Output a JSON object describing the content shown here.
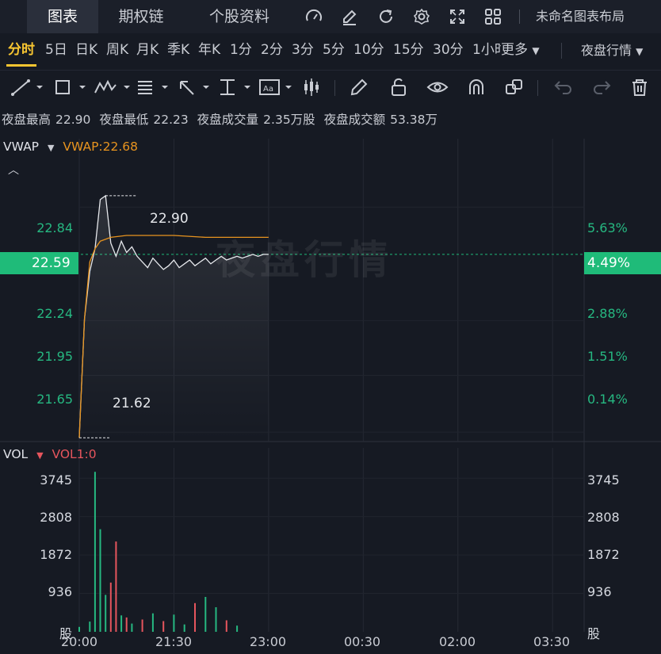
{
  "nav": {
    "tabs": [
      "图表",
      "期权链",
      "个股资料"
    ],
    "layout_label": "未命名图表布局",
    "icons": [
      "gauge-icon",
      "edit-icon",
      "refresh-icon",
      "settings-icon",
      "fullscreen-icon",
      "grid-icon"
    ]
  },
  "periods": {
    "items": [
      "分时",
      "5日",
      "日K",
      "周K",
      "月K",
      "季K",
      "年K",
      "1分",
      "2分",
      "3分",
      "5分",
      "10分",
      "15分",
      "30分",
      "1小时"
    ],
    "more_label": "更多",
    "session_label": "夜盘行情"
  },
  "stats": {
    "high_label": "夜盘最高",
    "high_value": "22.90",
    "low_label": "夜盘最低",
    "low_value": "22.23",
    "volume_label": "夜盘成交量",
    "volume_value": "2.35万股",
    "turnover_label": "夜盘成交额",
    "turnover_value": "53.38万"
  },
  "price_panel": {
    "indicator": "VWAP",
    "indicator_value": "VWAP:22.68",
    "y_labels": [
      "22.84",
      "22.24",
      "21.95",
      "21.65"
    ],
    "pct_labels": [
      "5.63%",
      "2.88%",
      "1.51%",
      "0.14%"
    ],
    "current_price": "22.59",
    "current_pct": "4.49%",
    "high_marker": "22.90",
    "low_marker": "21.62",
    "watermark": "夜盘行情"
  },
  "volume_panel": {
    "indicator": "VOL",
    "indicator_value": "VOL1:0",
    "y_labels": [
      "3745",
      "2808",
      "1872",
      "936"
    ],
    "unit": "股"
  },
  "time_axis": [
    "20:00",
    "21:30",
    "23:00",
    "00:30",
    "02:00",
    "03:30"
  ],
  "colors": {
    "up": "#26b881",
    "down": "#e6555d",
    "vwap": "#e8941f",
    "price_line": "#e6e8ec",
    "accent": "#f7c531"
  },
  "chart_data": {
    "type": "line",
    "series": [
      {
        "name": "price",
        "x": [
          "20:00",
          "20:05",
          "20:10",
          "20:15",
          "20:20",
          "20:25",
          "20:30",
          "20:35",
          "20:40",
          "20:45",
          "20:50",
          "20:55",
          "21:00",
          "21:05",
          "21:10",
          "21:15",
          "21:20",
          "21:25",
          "21:30",
          "21:35",
          "21:40",
          "21:45",
          "21:50",
          "21:55",
          "22:00",
          "22:05",
          "22:10",
          "22:15",
          "22:20",
          "22:25",
          "22:30",
          "22:35",
          "22:40",
          "22:45",
          "22:50",
          "22:55",
          "23:00"
        ],
        "values": [
          21.62,
          22.25,
          22.5,
          22.62,
          22.88,
          22.9,
          22.65,
          22.58,
          22.66,
          22.6,
          22.63,
          22.58,
          22.55,
          22.52,
          22.57,
          22.54,
          22.51,
          22.53,
          22.56,
          22.52,
          22.54,
          22.56,
          22.53,
          22.55,
          22.57,
          22.54,
          22.56,
          22.58,
          22.56,
          22.57,
          22.58,
          22.57,
          22.58,
          22.59,
          22.58,
          22.59,
          22.59
        ]
      },
      {
        "name": "VWAP",
        "x": [
          "20:00",
          "20:05",
          "20:10",
          "20:15",
          "20:20",
          "20:30",
          "20:45",
          "21:00",
          "21:30",
          "22:00",
          "22:30",
          "23:00"
        ],
        "values": [
          21.62,
          22.25,
          22.55,
          22.62,
          22.66,
          22.68,
          22.69,
          22.69,
          22.69,
          22.68,
          22.68,
          22.68
        ]
      },
      {
        "name": "VOL1",
        "x": [
          "20:00",
          "20:10",
          "20:15",
          "20:20",
          "20:25",
          "20:30",
          "20:35",
          "20:40",
          "20:45",
          "20:50",
          "21:00",
          "21:10",
          "21:20",
          "21:30",
          "21:40",
          "21:50",
          "22:00",
          "22:10",
          "22:20",
          "22:30"
        ],
        "values": [
          120,
          250,
          3900,
          2500,
          900,
          1200,
          2200,
          400,
          350,
          200,
          300,
          450,
          260,
          420,
          180,
          700,
          850,
          600,
          280,
          150
        ]
      }
    ],
    "ylim": [
      21.6,
      22.95
    ],
    "vol_ylim": [
      0,
      4000
    ],
    "x_ticks": [
      "20:00",
      "21:30",
      "23:00",
      "00:30",
      "02:00",
      "03:30"
    ]
  }
}
